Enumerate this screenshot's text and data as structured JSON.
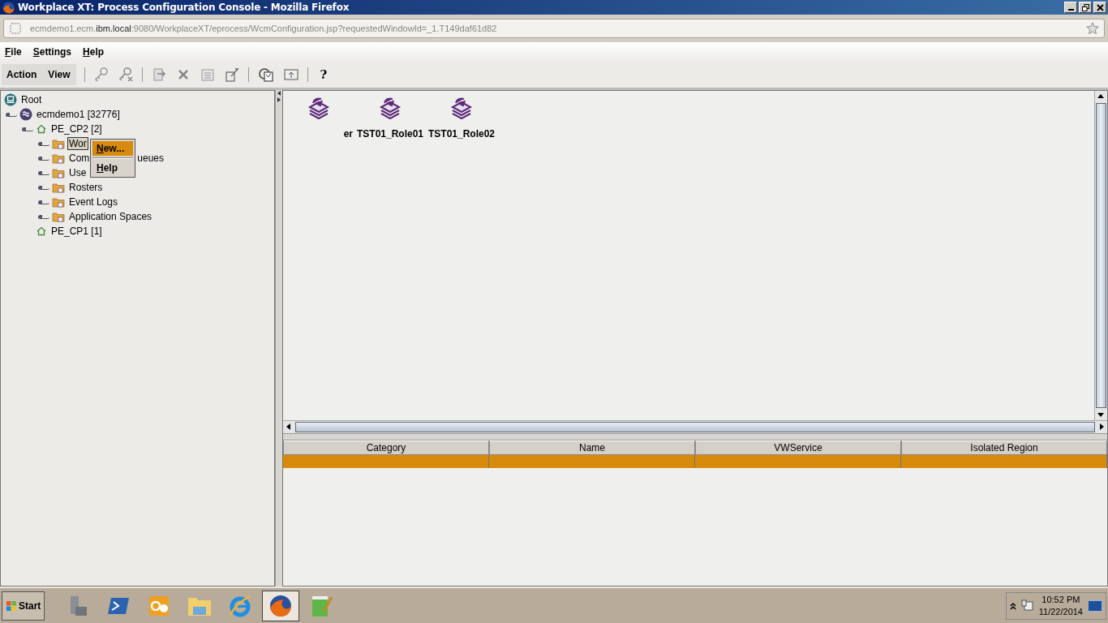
{
  "window": {
    "title": "Workplace XT: Process Configuration Console - Mozilla Firefox"
  },
  "address_bar": {
    "url_prefix": "ecmdemo1.ecm.",
    "url_domain": "ibm.local",
    "url_rest": ":9080/WorkplaceXT/eprocess/WcmConfiguration.jsp?requestedWindowId=_1.T149daf61d82"
  },
  "menu_bar": [
    "File",
    "Settings",
    "Help"
  ],
  "toolbar": {
    "menus": [
      "Action",
      "View"
    ],
    "help_button": "?"
  },
  "tree": [
    {
      "label": "Root",
      "kind": "root",
      "selected": false,
      "children": [
        {
          "label": "ecmdemo1 [32776]",
          "kind": "server",
          "selected": false,
          "children": [
            {
              "label": "PE_CP2 [2]",
              "kind": "region",
              "selected": false,
              "children": [
                {
                  "label": "Wor",
                  "kind": "folder",
                  "selected": true
                },
                {
                  "label": "Com",
                  "label_tail": "ueues",
                  "kind": "folder",
                  "selected": false
                },
                {
                  "label": "Use",
                  "kind": "folder",
                  "selected": false
                },
                {
                  "label": "Rosters",
                  "kind": "folder",
                  "selected": false
                },
                {
                  "label": "Event Logs",
                  "kind": "folder",
                  "selected": false
                },
                {
                  "label": "Application Spaces",
                  "kind": "folder",
                  "selected": false
                }
              ]
            },
            {
              "label": "PE_CP1 [1]",
              "kind": "region",
              "selected": false
            }
          ]
        }
      ]
    }
  ],
  "context_menu": [
    {
      "label": "New...",
      "selected": true
    },
    {
      "label": "Help",
      "selected": false
    }
  ],
  "icon_view": [
    {
      "label": "er"
    },
    {
      "label": "TST01_Role01"
    },
    {
      "label": "TST01_Role02"
    }
  ],
  "table": {
    "columns": [
      "Category",
      "Name",
      "VWService",
      "Isolated Region"
    ],
    "rows": [
      {
        "selected": true
      }
    ]
  },
  "taskbar": {
    "start": "Start",
    "apps": [
      {
        "kind": "server-tools",
        "selected": false
      },
      {
        "kind": "powershell",
        "selected": false
      },
      {
        "kind": "outlook",
        "selected": false
      },
      {
        "kind": "folder",
        "selected": false
      },
      {
        "kind": "ie",
        "selected": false
      },
      {
        "kind": "firefox",
        "selected": true
      },
      {
        "kind": "notepad",
        "selected": false
      }
    ],
    "time": "10:52 PM",
    "date": "11/22/2014"
  }
}
